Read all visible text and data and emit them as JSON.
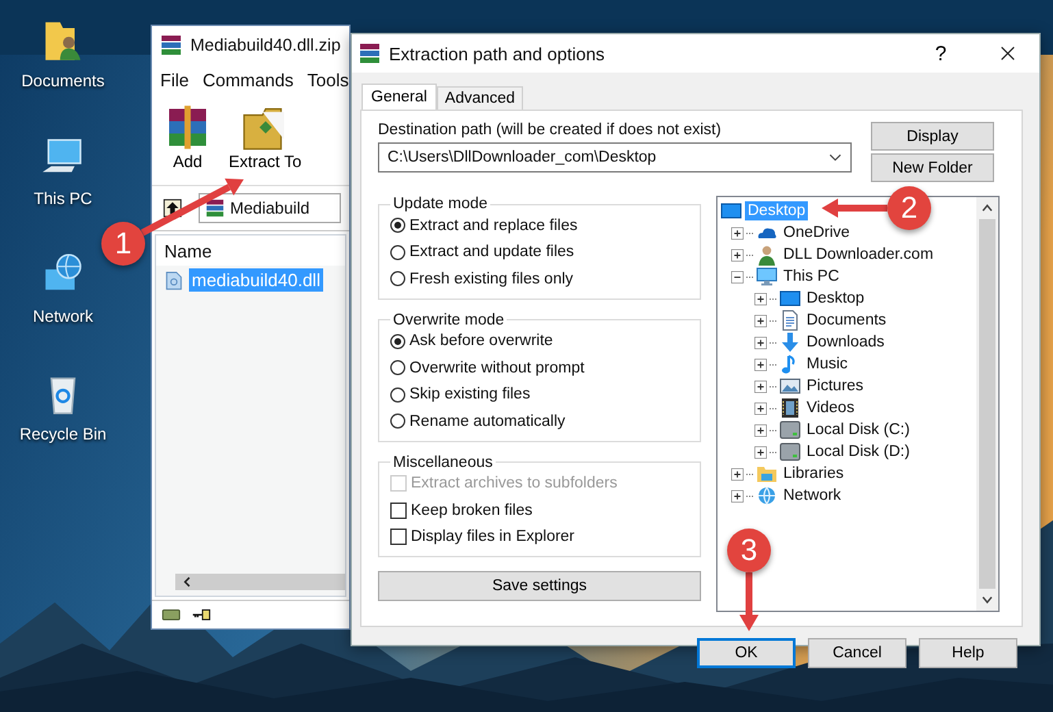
{
  "desktop_icons": [
    {
      "label": "Documents",
      "kind": "documents"
    },
    {
      "label": "This PC",
      "kind": "pc"
    },
    {
      "label": "Network",
      "kind": "network"
    },
    {
      "label": "Recycle Bin",
      "kind": "recycle"
    }
  ],
  "archive_window": {
    "title": "Mediabuild40.dll.zip",
    "menu": [
      "File",
      "Commands",
      "Tools"
    ],
    "toolbar": [
      {
        "label": "Add",
        "kind": "add"
      },
      {
        "label": "Extract To",
        "kind": "extract"
      }
    ],
    "path": "Mediabuild",
    "columns": [
      "Name"
    ],
    "files": [
      {
        "name": "mediabuild40.dll",
        "selected": true
      }
    ]
  },
  "dialog": {
    "title": "Extraction path and options",
    "help": "?",
    "tabs": [
      {
        "label": "General",
        "selected": true
      },
      {
        "label": "Advanced",
        "selected": false
      }
    ],
    "destination_label": "Destination path (will be created if does not exist)",
    "destination_value": "C:\\Users\\DllDownloader_com\\Desktop",
    "side_buttons": [
      "Display",
      "New Folder"
    ],
    "groups": [
      {
        "title": "Update mode",
        "options": [
          {
            "label": "Extract and replace files",
            "kind": "radio",
            "selected": true
          },
          {
            "label": "Extract and update files",
            "kind": "radio",
            "selected": false
          },
          {
            "label": "Fresh existing files only",
            "kind": "radio",
            "selected": false
          }
        ]
      },
      {
        "title": "Overwrite mode",
        "options": [
          {
            "label": "Ask before overwrite",
            "kind": "radio",
            "selected": true
          },
          {
            "label": "Overwrite without prompt",
            "kind": "radio",
            "selected": false
          },
          {
            "label": "Skip existing files",
            "kind": "radio",
            "selected": false
          },
          {
            "label": "Rename automatically",
            "kind": "radio",
            "selected": false
          }
        ]
      },
      {
        "title": "Miscellaneous",
        "options": [
          {
            "label": "Extract archives to subfolders",
            "kind": "checkbox",
            "checked": false,
            "disabled": true
          },
          {
            "label": "Keep broken files",
            "kind": "checkbox",
            "checked": false,
            "disabled": false
          },
          {
            "label": "Display files in Explorer",
            "kind": "checkbox",
            "checked": false,
            "disabled": false
          }
        ]
      }
    ],
    "save_button": "Save settings",
    "tree": [
      {
        "label": "Desktop",
        "kind": "desktop",
        "selected": true,
        "children": [
          {
            "label": "OneDrive",
            "kind": "cloud",
            "selected": false,
            "expanded": false
          },
          {
            "label": "DLL Downloader.com",
            "kind": "person",
            "selected": false,
            "expanded": false
          },
          {
            "label": "This PC",
            "kind": "pc",
            "selected": false,
            "expanded": true,
            "children": [
              {
                "label": "Desktop",
                "kind": "desktop",
                "selected": false,
                "expanded": false
              },
              {
                "label": "Documents",
                "kind": "document",
                "selected": false,
                "expanded": false
              },
              {
                "label": "Downloads",
                "kind": "download",
                "selected": false,
                "expanded": false
              },
              {
                "label": "Music",
                "kind": "music",
                "selected": false,
                "expanded": false
              },
              {
                "label": "Pictures",
                "kind": "picture",
                "selected": false,
                "expanded": false
              },
              {
                "label": "Videos",
                "kind": "video",
                "selected": false,
                "expanded": false
              },
              {
                "label": "Local Disk (C:)",
                "kind": "drive",
                "selected": false,
                "expanded": false
              },
              {
                "label": "Local Disk (D:)",
                "kind": "drive",
                "selected": false,
                "expanded": false
              }
            ]
          },
          {
            "label": "Libraries",
            "kind": "library",
            "selected": false,
            "expanded": false
          },
          {
            "label": "Network",
            "kind": "network",
            "selected": false,
            "expanded": false
          }
        ]
      }
    ],
    "buttons": [
      {
        "label": "OK",
        "default": true
      },
      {
        "label": "Cancel",
        "default": false
      },
      {
        "label": "Help",
        "default": false
      }
    ]
  },
  "annotations": [
    {
      "number": "1"
    },
    {
      "number": "2"
    },
    {
      "number": "3"
    }
  ]
}
